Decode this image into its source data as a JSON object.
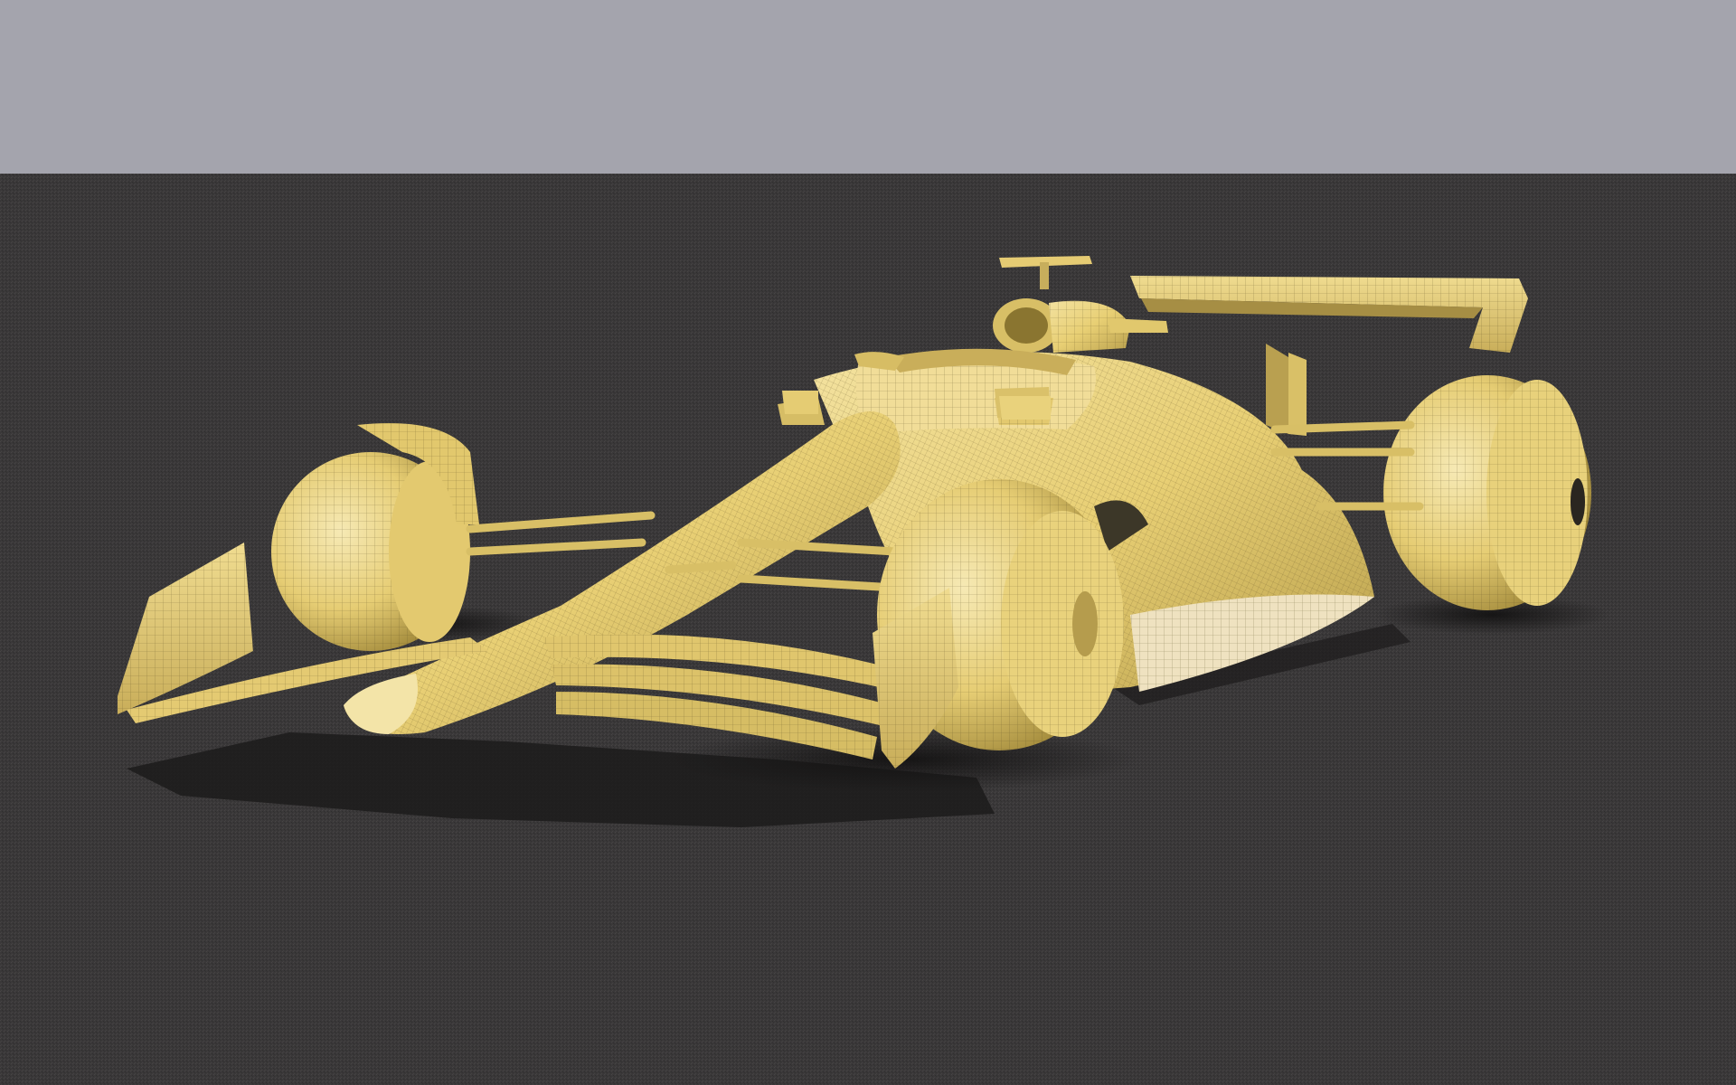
{
  "scene": {
    "subject": "formula-1-race-car-wireframe-render",
    "colors": {
      "sky": "#a4a4ad",
      "ground": "#3a3839",
      "ground_dark": "#2a2929",
      "body": "#ead27a",
      "body_light": "#f4e3a3",
      "body_shadow": "#b39a4a",
      "wire": "#5a4c22",
      "shadow": "#1b1a1a",
      "underside": "#efe2c0"
    }
  }
}
